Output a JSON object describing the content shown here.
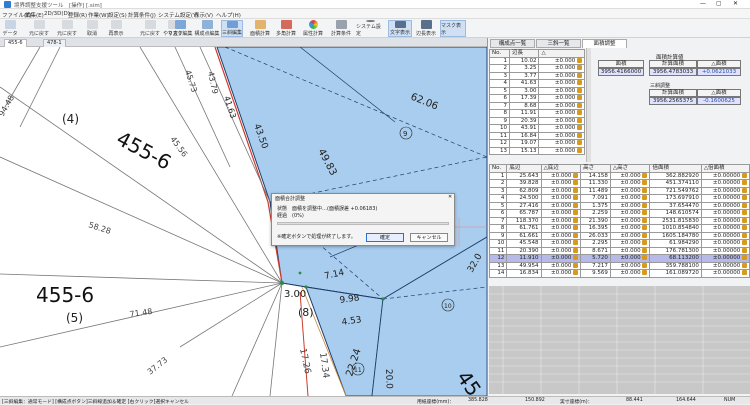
{
  "window": {
    "title": "境界調整支援ツール　[操作]  [.sim]"
  },
  "menu": [
    "ファイル(F)",
    "編集(E)",
    "2D/3D(D)",
    "登録(R)",
    "作業(W)",
    "設定(S)",
    "計算条件(J)",
    "システム設定(Y)",
    "表示(V)",
    "ヘルプ(H)"
  ],
  "toolbar": {
    "buttons": [
      "データ",
      "元に戻す",
      "元に戻す",
      "取消",
      "再表示",
      "元に戻す",
      "やり直す",
      "マスク編集",
      "構成点編集",
      "三斜編集",
      "面積計算",
      "多角計算",
      "属性計算",
      "計算条件",
      "システム設定",
      "文字表示",
      "辺長表示",
      "マスク表示"
    ]
  },
  "tabs": [
    "455-6",
    "478-1"
  ],
  "map": {
    "lot_left": "455-6",
    "lot_top": "455-6",
    "parcel_4": "(4)",
    "parcel_5": "(5)",
    "parcel_8": "(8)",
    "circ_9": "9",
    "circ_10": "10",
    "circ_11": "11",
    "d_6206": "62.06",
    "d_4983": "49.83",
    "d_4350": "43.50",
    "d_3979": "43.79",
    "d_4163": "41.63",
    "d_4573": "45.73",
    "d_4556": "45.56",
    "d_5828": "58.28",
    "d_7148": "71.48",
    "d_9448": "94.48",
    "d_3773": "37.73",
    "d_714": "7.14",
    "d_998": "9.98",
    "d_453": "4.53",
    "d_300": "3.00",
    "d_1726": "17.26",
    "d_1734": "17.34",
    "d_2224": "22.24",
    "d_2000": "20.0",
    "d_3200": "32.0",
    "lot_frag": "45"
  },
  "dialog": {
    "title": "面積合計調整",
    "line1": "状態　面積を調整中…(面積誤差 +0.06183)",
    "line2": "経過　(0%)",
    "note": "※確定ボタンで処理が終了します。",
    "ok": "確定",
    "cancel": "キャンセル"
  },
  "right": {
    "tabs": [
      "構成点一覧",
      "三斜一覧",
      "面積調整"
    ],
    "head_no": "No.",
    "head_len": "辺長",
    "top_rows": [
      [
        "1",
        "10.02",
        "±0.000"
      ],
      [
        "2",
        "3.25",
        "±0.000"
      ],
      [
        "3",
        "3.77",
        "±0.000"
      ],
      [
        "4",
        "41.63",
        "±0.000"
      ],
      [
        "5",
        "3.00",
        "±0.000"
      ],
      [
        "6",
        "17.39",
        "±0.000"
      ],
      [
        "7",
        "8.68",
        "±0.000"
      ],
      [
        "8",
        "11.91",
        "±0.000"
      ],
      [
        "9",
        "20.39",
        "±0.000"
      ],
      [
        "10",
        "43.91",
        "±0.000"
      ],
      [
        "11",
        "16.84",
        "±0.000"
      ],
      [
        "12",
        "19.07",
        "±0.000"
      ],
      [
        "13",
        "15.13",
        "±0.000"
      ]
    ],
    "area_label": "面積計算値",
    "area_head": "面積",
    "area_val": "3956.4166000",
    "calc_head": "計算面積",
    "calc_delta_head": "△面積",
    "calc_val": "3956.4783033",
    "calc_delta": "+0.0621033",
    "adj_label": "三斜調整",
    "adj_val": "3956.2565375",
    "adj_delta": "-0.1600625",
    "bottom_head": [
      "No.",
      "底辺",
      "△底辺",
      "高さ",
      "△高さ",
      "倍面積",
      "△倍面積"
    ],
    "bottom_rows": [
      [
        "1",
        "25.643",
        "±0.000",
        "14.158",
        "±0.000",
        "362.882920",
        "±0.00000"
      ],
      [
        "2",
        "39.828",
        "±0.000",
        "11.330",
        "±0.000",
        "451.374110",
        "±0.00000"
      ],
      [
        "3",
        "62.809",
        "±0.000",
        "11.489",
        "±0.000",
        "721.549762",
        "±0.00000"
      ],
      [
        "4",
        "24.500",
        "±0.000",
        "7.091",
        "±0.000",
        "173.697910",
        "±0.00000"
      ],
      [
        "5",
        "27.416",
        "±0.000",
        "1.375",
        "±0.000",
        "37.654470",
        "±0.00000"
      ],
      [
        "6",
        "65.787",
        "±0.000",
        "2.259",
        "±0.000",
        "148.610574",
        "±0.00000"
      ],
      [
        "7",
        "118.370",
        "±0.000",
        "21.390",
        "±0.000",
        "2531.815830",
        "±0.00000"
      ],
      [
        "8",
        "61.761",
        "±0.000",
        "16.395",
        "±0.000",
        "1010.854840",
        "±0.00000"
      ],
      [
        "9",
        "61.661",
        "±0.000",
        "26.033",
        "±0.000",
        "1605.184780",
        "±0.00000"
      ],
      [
        "10",
        "45.548",
        "±0.000",
        "2.295",
        "±0.000",
        "61.984290",
        "±0.00000"
      ],
      [
        "11",
        "20.390",
        "±0.000",
        "8.671",
        "±0.000",
        "176.781300",
        "±0.00000"
      ],
      [
        "12",
        "11.910",
        "±0.000",
        "5.720",
        "±0.000",
        "68.113200",
        "±0.00000"
      ],
      [
        "13",
        "49.954",
        "±0.000",
        "7.217",
        "±0.000",
        "359.788100",
        "±0.00000"
      ],
      [
        "14",
        "16.834",
        "±0.000",
        "9.569",
        "±0.000",
        "161.089720",
        "±0.00000"
      ]
    ]
  },
  "status": {
    "left": "[三斜編集：通常モード]  [構成点ボタン]三斜線追加＆確定  [右クリック]選択キャンセル",
    "scale_label": "用紙座標(mm)：",
    "x": "385.828",
    "y": "150.892",
    "real_label": "実寸座標(m)：",
    "rx": "88.441",
    "ry": "164.644",
    "mode": "NUM"
  },
  "colors": {
    "parcel_fill": "#a9cdee",
    "selected_row": "#b7b9e8",
    "line": "#1e3d6a",
    "red": "#cc3d2d",
    "lock": "#d89a1d"
  }
}
